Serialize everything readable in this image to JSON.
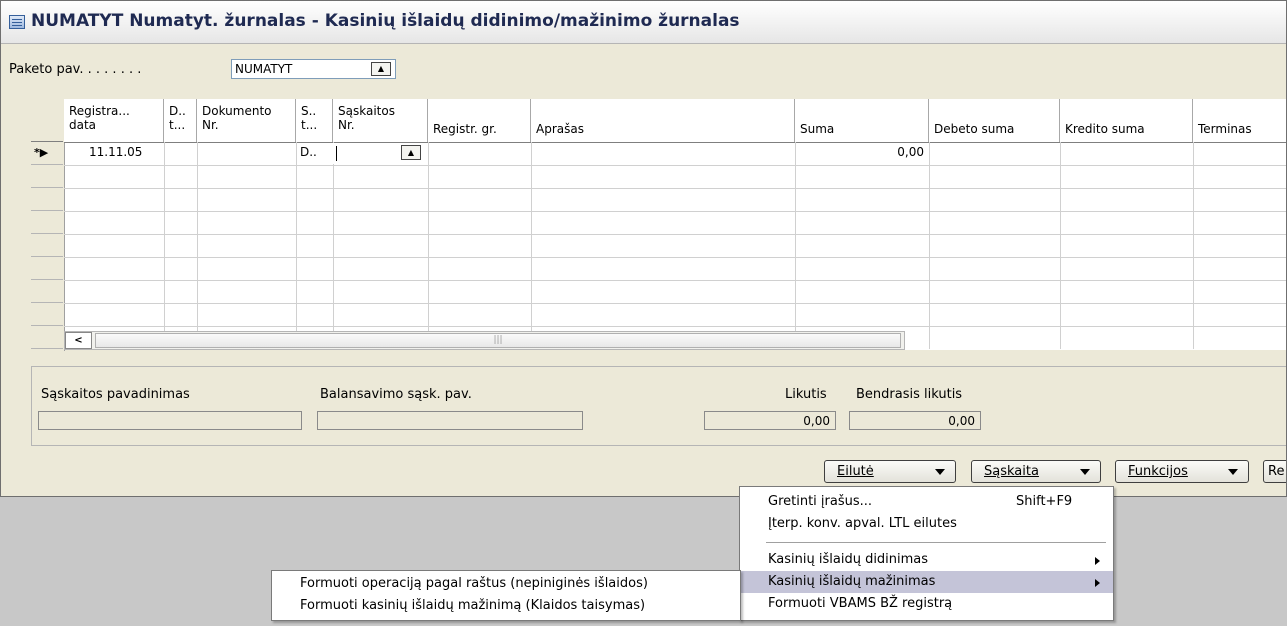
{
  "window": {
    "title": "NUMATYT Numatyt. žurnalas - Kasinių išlaidų didinimo/mažinimo žurnalas"
  },
  "header": {
    "label": "Paketo pav. . . . . . . .",
    "value": "NUMATYT",
    "lookup_icon": "up-arrow-icon"
  },
  "grid": {
    "columns": [
      {
        "line1": "Registra...",
        "line2": "data"
      },
      {
        "line1": "D..",
        "line2": "t..."
      },
      {
        "line1": "Dokumento",
        "line2": "Nr."
      },
      {
        "line1": "S..",
        "line2": "t..."
      },
      {
        "line1": "Sąskaitos",
        "line2": "Nr."
      },
      {
        "line1": "",
        "line2": "Registr. gr."
      },
      {
        "line1": "",
        "line2": "Aprašas"
      },
      {
        "line1": "",
        "line2": "Suma"
      },
      {
        "line1": "",
        "line2": "Debeto suma"
      },
      {
        "line1": "",
        "line2": "Kredito suma"
      },
      {
        "line1": "",
        "line2": "Terminas"
      }
    ],
    "row_marker": "*▶",
    "rows": [
      {
        "date": "11.11.05",
        "doc_type_short": "D..",
        "amount": "0,00"
      }
    ]
  },
  "info": {
    "account_name_label": "Sąskaitos pavadinimas",
    "balancing_label": "Balansavimo sąsk. pav.",
    "balance_label": "Likutis",
    "total_balance_label": "Bendrasis likutis",
    "balance_value": "0,00",
    "total_balance_value": "0,00"
  },
  "buttons": {
    "line": "Eilutė",
    "account": "Sąskaita",
    "functions": "Funkcijos",
    "partial": "Re"
  },
  "menu": {
    "items": [
      {
        "label": "Gretinti įrašus...",
        "shortcut": "Shift+F9"
      },
      {
        "label": "Įterp. konv. apval. LTL eilutes"
      },
      {
        "label": "Kasinių išlaidų didinimas"
      },
      {
        "label": "Kasinių išlaidų mažinimas"
      },
      {
        "label": "Formuoti VBAMS BŽ registrą"
      }
    ]
  },
  "submenu": {
    "items": [
      {
        "label": "Formuoti operaciją pagal raštus (nepiniginės išlaidos)"
      },
      {
        "label": "Formuoti kasinių išlaidų mažinimą (Klaidos taisymas)"
      }
    ]
  }
}
